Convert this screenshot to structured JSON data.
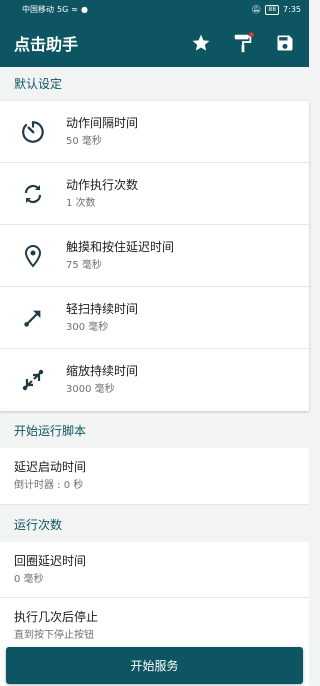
{
  "status_bar": {
    "carrier": "中国移动",
    "network": "5G",
    "battery": "88",
    "time": "7:35"
  },
  "app_bar": {
    "title": "点击助手",
    "actions": [
      "star-icon",
      "paint-roller-icon",
      "save-icon"
    ]
  },
  "sections": {
    "defaults": {
      "header": "默认设定",
      "items": [
        {
          "icon": "timer-icon",
          "title": "动作间隔时间",
          "value": "50 毫秒"
        },
        {
          "icon": "repeat-icon",
          "title": "动作执行次数",
          "value": "1 次数"
        },
        {
          "icon": "location-pin-icon",
          "title": "触摸和按住延迟时间",
          "value": "75 毫秒"
        },
        {
          "icon": "swipe-arrow-icon",
          "title": "轻扫持续时间",
          "value": "300 毫秒"
        },
        {
          "icon": "zoom-arrows-icon",
          "title": "缩放持续时间",
          "value": "3000 毫秒"
        }
      ]
    },
    "start_script": {
      "header": "开始运行脚本",
      "items": [
        {
          "title": "延迟启动时间",
          "value": "倒计时器 : 0 秒"
        }
      ]
    },
    "run_count": {
      "header": "运行次数",
      "items": [
        {
          "title": "回圈延迟时间",
          "value": "0 毫秒"
        },
        {
          "title": "执行几次后停止",
          "value": "直到按下停止按钮"
        }
      ]
    }
  },
  "start_button": {
    "label": "开始服务"
  },
  "colors": {
    "primary": "#0e5563",
    "accent_dot": "#e53935"
  }
}
